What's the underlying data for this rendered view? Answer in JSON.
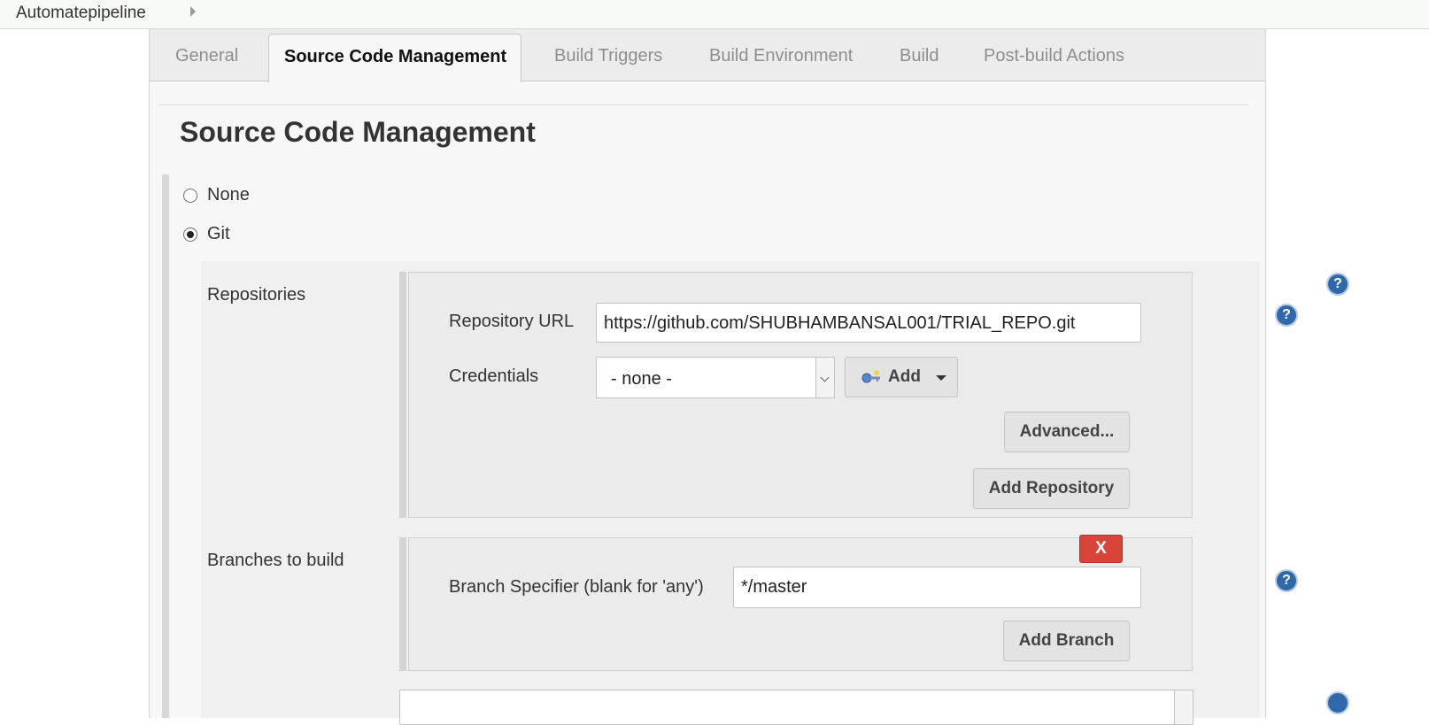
{
  "breadcrumb": {
    "job": "Automatepipeline"
  },
  "tabs": [
    {
      "label": "General"
    },
    {
      "label": "Source Code Management"
    },
    {
      "label": "Build Triggers"
    },
    {
      "label": "Build Environment"
    },
    {
      "label": "Build"
    },
    {
      "label": "Post-build Actions"
    }
  ],
  "active_tab": "Source Code Management",
  "section": {
    "title": "Source Code Management"
  },
  "scm": {
    "options": [
      {
        "label": "None",
        "checked": false
      },
      {
        "label": "Git",
        "checked": true
      }
    ]
  },
  "repositories": {
    "label": "Repositories",
    "url_label": "Repository URL",
    "url_value": "https://github.com/SHUBHAMBANSAL001/TRIAL_REPO.git",
    "credentials_label": "Credentials",
    "credentials_value": "- none -",
    "add_label": "Add",
    "advanced_label": "Advanced...",
    "add_repository_label": "Add Repository"
  },
  "branches": {
    "label": "Branches to build",
    "specifier_label": "Branch Specifier (blank for 'any')",
    "specifier_value": "*/master",
    "delete_label": "X",
    "add_branch_label": "Add Branch"
  },
  "help_symbol": "?",
  "icons": [
    "chevron-right-icon",
    "help-icon",
    "key-icon",
    "caret-down-icon",
    "select-arrow-icon"
  ],
  "colors": {
    "help": "#2f69a9",
    "delete": "#d9443a"
  }
}
